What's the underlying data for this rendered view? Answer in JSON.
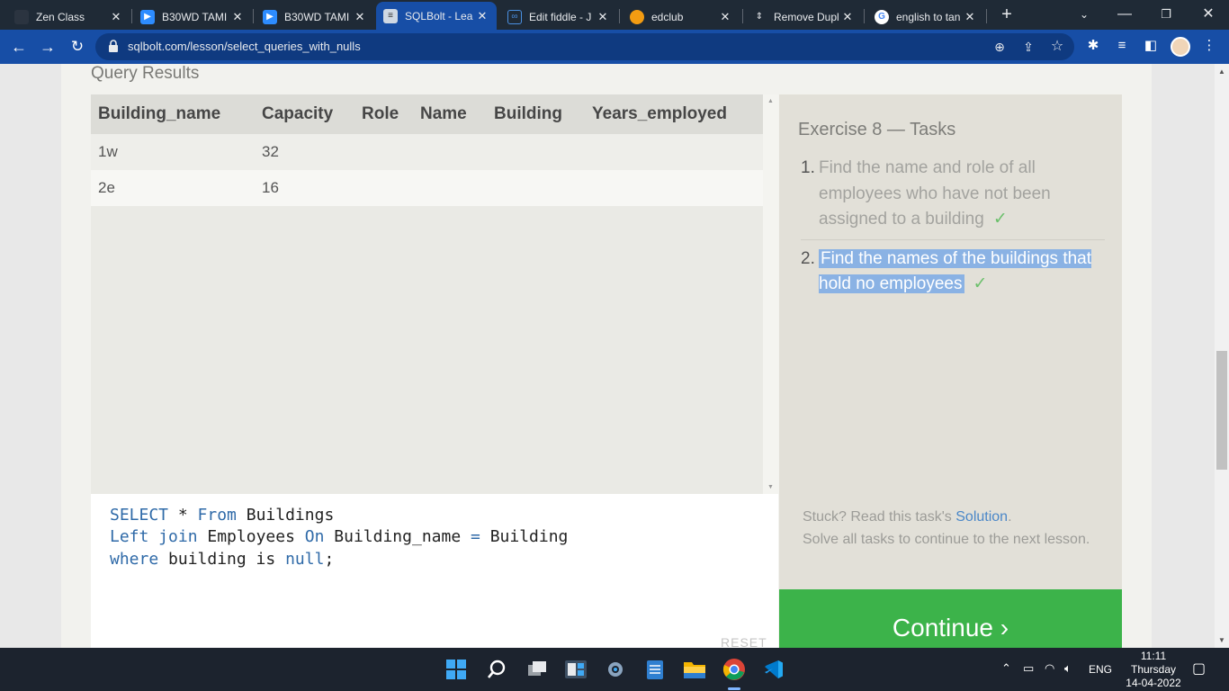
{
  "browser": {
    "tabs": [
      {
        "title": "Zen Class",
        "icon": "zen-class-icon",
        "active": false
      },
      {
        "title": "B30WD TAMI",
        "icon": "zoom-icon",
        "active": false
      },
      {
        "title": "B30WD TAMI",
        "icon": "zoom-icon",
        "active": false
      },
      {
        "title": "SQLBolt - Lea",
        "icon": "sqlbolt-icon",
        "active": true
      },
      {
        "title": "Edit fiddle - J",
        "icon": "jsfiddle-icon",
        "active": false
      },
      {
        "title": "edclub",
        "icon": "edclub-icon",
        "active": false
      },
      {
        "title": "Remove Dupl",
        "icon": "geeks-icon",
        "active": false
      },
      {
        "title": "english to tan",
        "icon": "google-icon",
        "active": false
      }
    ],
    "url": "sqlbolt.com/lesson/select_queries_with_nulls"
  },
  "page": {
    "query_results_title": "Query Results",
    "columns": [
      "Building_name",
      "Capacity",
      "Role",
      "Name",
      "Building",
      "Years_employed"
    ],
    "rows": [
      [
        "1w",
        "32",
        "",
        "",
        "",
        ""
      ],
      [
        "2e",
        "16",
        "",
        "",
        "",
        ""
      ]
    ],
    "exercise_title": "Exercise 8 — Tasks",
    "tasks": [
      {
        "num": "1.",
        "text": "Find the name and role of all employees who have not been assigned to a building",
        "done_mark": "✓"
      },
      {
        "num": "2.",
        "text": "Find the names of the buildings that hold no employees",
        "done_mark": "✓"
      }
    ],
    "stuck_prefix": "Stuck? Read this task's ",
    "solution_link": "Solution",
    "stuck_suffix": ".",
    "stuck_line2": "Solve all tasks to continue to the next lesson.",
    "sql_lines": {
      "l1_kw1": "SELECT",
      "l1_op": " * ",
      "l1_kw2": "From",
      "l1_rest": " Buildings",
      "l2_kw1": "Left join",
      "l2_mid": " Employees ",
      "l2_kw2": "On",
      "l2_rest": " Building_name ",
      "l2_op": "=",
      "l2_end": " Building",
      "l3_kw1": "where",
      "l3_mid": " building is ",
      "l3_kw2": "null",
      "l3_end": ";"
    },
    "reset_label": "RESET",
    "continue_label": "Continue ›"
  },
  "taskbar": {
    "language": "ENG",
    "time": "11:11",
    "day": "Thursday",
    "date": "14-04-2022"
  }
}
